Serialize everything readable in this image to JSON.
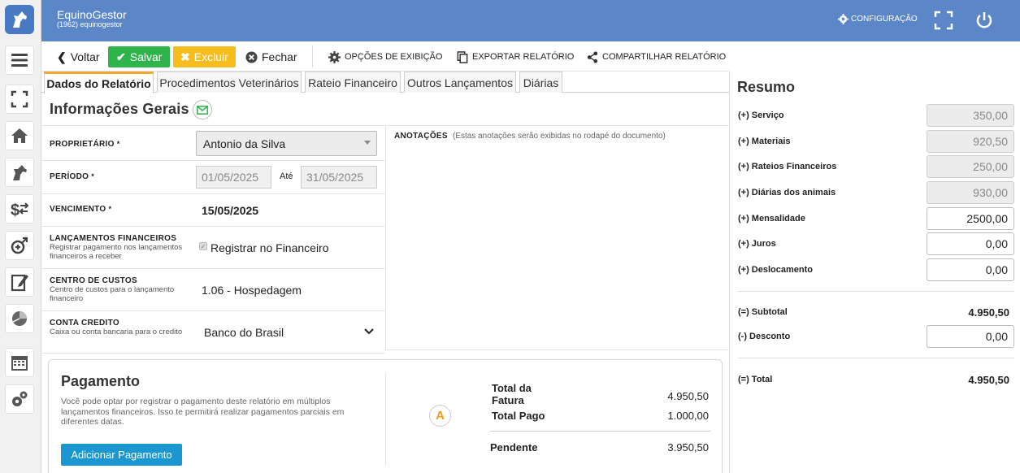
{
  "header": {
    "app_title": "EquinoGestor",
    "app_subtitle": "(1962) equinogestor",
    "config_label": "CONFIGURAÇÃO"
  },
  "sidebar": {
    "items": [
      "menu-icon",
      "fullscreen-icon",
      "home-icon",
      "horse-icon",
      "finance-icon",
      "breeding-icon",
      "notes-icon",
      "reports-icon",
      "calendar-icon",
      "settings-icon"
    ]
  },
  "toolbar": {
    "back_label": "Voltar",
    "save_label": "Salvar",
    "delete_label": "Excluir",
    "close_label": "Fechar",
    "display_options_label": "OPÇÕES DE EXIBIÇÃO",
    "export_label": "EXPORTAR RELATÓRIO",
    "share_label": "COMPARTILHAR RELATÓRIO"
  },
  "tabs": [
    {
      "label": "Dados do Relatório"
    },
    {
      "label": "Procedimentos Veterinários"
    },
    {
      "label": "Rateio Financeiro"
    },
    {
      "label": "Outros Lançamentos"
    },
    {
      "label": "Diárias"
    }
  ],
  "section_title": "Informações Gerais",
  "form": {
    "owner": {
      "label": "PROPRIETÁRIO",
      "value": "Antonio da Silva"
    },
    "period": {
      "label": "PERÍODO",
      "start": "01/05/2025",
      "until": "Até",
      "end": "31/05/2025"
    },
    "due": {
      "label": "VENCIMENTO",
      "value": "15/05/2025"
    },
    "financial": {
      "label": "LANÇAMENTOS FINANCEIROS",
      "help": "Registrar pagamento nos lançamentos financeiros a receber",
      "checkbox_label": "Registrar no Financeiro",
      "checked": true
    },
    "cost_center": {
      "label": "CENTRO DE CUSTOS",
      "help": "Centro de custos para o lançamento financeiro",
      "value": "1.06 - Hospedagem"
    },
    "credit_account": {
      "label": "CONTA CREDITO",
      "help": "Caixa ou conta bancaria para o credito",
      "value": "Banco do Brasil"
    },
    "required_mark": "*"
  },
  "notes": {
    "label": "ANOTAÇÕES",
    "hint": "(Estas anotações serão exibidas no rodapé do documento)"
  },
  "payment": {
    "title": "Pagamento",
    "description": "Você pode optar por registrar o pagamento deste relatório em múltiplos lançamentos financeiros. Isso te permitirá realizar pagamentos parciais em diferentes datas.",
    "add_button": "Adicionar Pagamento",
    "badge": "A",
    "total_invoice_label": "Total da Fatura",
    "total_invoice_value": "4.950,50",
    "total_paid_label": "Total Pago",
    "total_paid_value": "1.000,00",
    "pending_label": "Pendente",
    "pending_value": "3.950,50"
  },
  "summary": {
    "title": "Resumo",
    "lines": [
      {
        "label": "(+) Serviço",
        "value": "350,00"
      },
      {
        "label": "(+) Materiais",
        "value": "920,50"
      },
      {
        "label": "(+) Rateios Financeiros",
        "value": "250,00"
      },
      {
        "label": "(+) Diárias dos animais",
        "value": "930,00"
      },
      {
        "label": "(+) Mensalidade",
        "value": "2500,00"
      },
      {
        "label": "(+) Juros",
        "value": "0,00"
      },
      {
        "label": "(+) Deslocamento",
        "value": "0,00"
      }
    ],
    "subtotal_label": "(=) Subtotal",
    "subtotal_value": "4.950,50",
    "discount_label": "(-) Desconto",
    "discount_value": "0,00",
    "total_label": "(=) Total",
    "total_value": "4.950,50"
  }
}
